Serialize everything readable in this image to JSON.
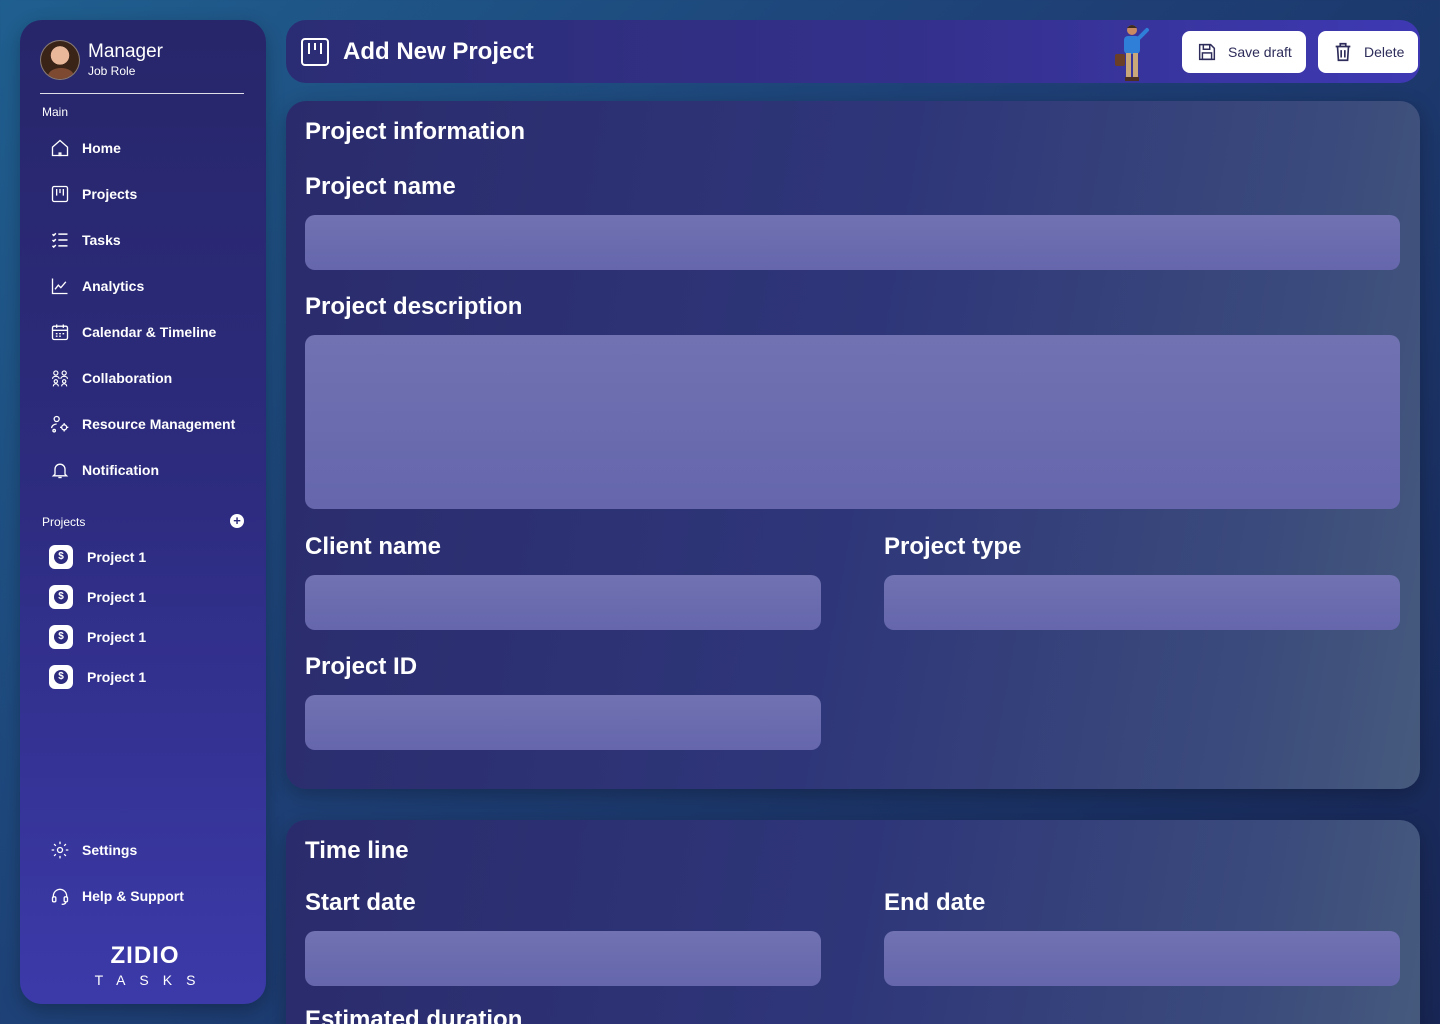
{
  "profile": {
    "name": "Manager",
    "role": "Job Role"
  },
  "nav": {
    "section_label": "Main",
    "items": [
      {
        "label": "Home",
        "icon": "home-icon"
      },
      {
        "label": "Projects",
        "icon": "projects-icon"
      },
      {
        "label": "Tasks",
        "icon": "tasks-icon"
      },
      {
        "label": "Analytics",
        "icon": "analytics-icon"
      },
      {
        "label": "Calendar & Timeline",
        "icon": "calendar-icon"
      },
      {
        "label": "Collaboration",
        "icon": "collaboration-icon"
      },
      {
        "label": "Resource Management",
        "icon": "resource-icon"
      },
      {
        "label": "Notification",
        "icon": "bell-icon"
      }
    ]
  },
  "projects_section": {
    "label": "Projects",
    "add_symbol": "+",
    "items": [
      {
        "label": "Project 1",
        "badge": "$"
      },
      {
        "label": "Project 1",
        "badge": "$"
      },
      {
        "label": "Project 1",
        "badge": "$"
      },
      {
        "label": "Project 1",
        "badge": "$"
      }
    ]
  },
  "footer_nav": {
    "settings": "Settings",
    "help": "Help & Support"
  },
  "logo": {
    "main": "ZIDIO",
    "sub": "TASKS"
  },
  "header": {
    "title": "Add New Project",
    "save_label": "Save draft",
    "delete_label": "Delete"
  },
  "project_info": {
    "title": "Project information",
    "name_label": "Project name",
    "name_value": "",
    "description_label": "Project description",
    "description_value": "",
    "client_label": "Client name",
    "client_value": "",
    "type_label": "Project type",
    "type_value": "",
    "id_label": "Project ID",
    "id_value": ""
  },
  "timeline": {
    "title": "Time line",
    "start_label": "Start date",
    "start_value": "",
    "end_label": "End date",
    "end_value": "",
    "duration_label": "Estimated duration"
  },
  "colors": {
    "sidebar": "#2c2b7d",
    "input": "#6a6bad",
    "button": "#ffffff",
    "button_text": "#2d2c5a"
  }
}
